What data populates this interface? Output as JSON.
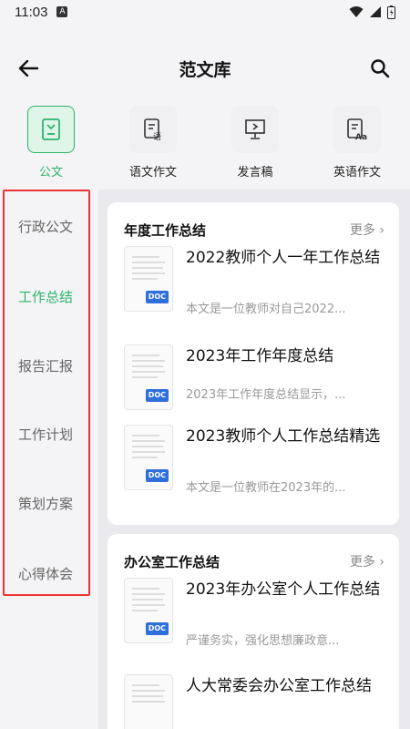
{
  "status_bar": {
    "time": "11:03",
    "notif_icon": "A"
  },
  "header": {
    "title": "范文库"
  },
  "categories": [
    {
      "label": "公文",
      "icon": "official-doc-icon",
      "active": true
    },
    {
      "label": "语文作文",
      "icon": "chinese-essay-icon",
      "active": false
    },
    {
      "label": "发言稿",
      "icon": "speech-icon",
      "active": false
    },
    {
      "label": "英语作文",
      "icon": "english-essay-icon",
      "active": false
    }
  ],
  "sidebar": {
    "items": [
      {
        "label": "行政公文"
      },
      {
        "label": "工作总结"
      },
      {
        "label": "报告汇报"
      },
      {
        "label": "工作计划"
      },
      {
        "label": "策划方案"
      },
      {
        "label": "心得体会"
      }
    ],
    "active_index": 1
  },
  "sections": [
    {
      "title": "年度工作总结",
      "more": "更多",
      "docs": [
        {
          "title": "2022教师个人一年工作总结",
          "desc": "本文是一位教师对自己2022...",
          "badge": "DOC"
        },
        {
          "title": "2023年工作年度总结",
          "desc": "2023年工作年度总结显示，...",
          "badge": "DOC"
        },
        {
          "title": "2023教师个人工作总结精选",
          "desc": "本文是一位教师在2023年的...",
          "badge": "DOC"
        }
      ]
    },
    {
      "title": "办公室工作总结",
      "more": "更多",
      "docs": [
        {
          "title": "2023年办公室个人工作总结",
          "desc": "严谨务实，强化思想廉政意...",
          "badge": "DOC"
        },
        {
          "title": "人大常委会办公室工作总结",
          "desc": "",
          "badge": ""
        }
      ]
    }
  ],
  "colors": {
    "accent": "#2db46c",
    "badge": "#2f6fdc",
    "highlight_box": "#e33333"
  }
}
